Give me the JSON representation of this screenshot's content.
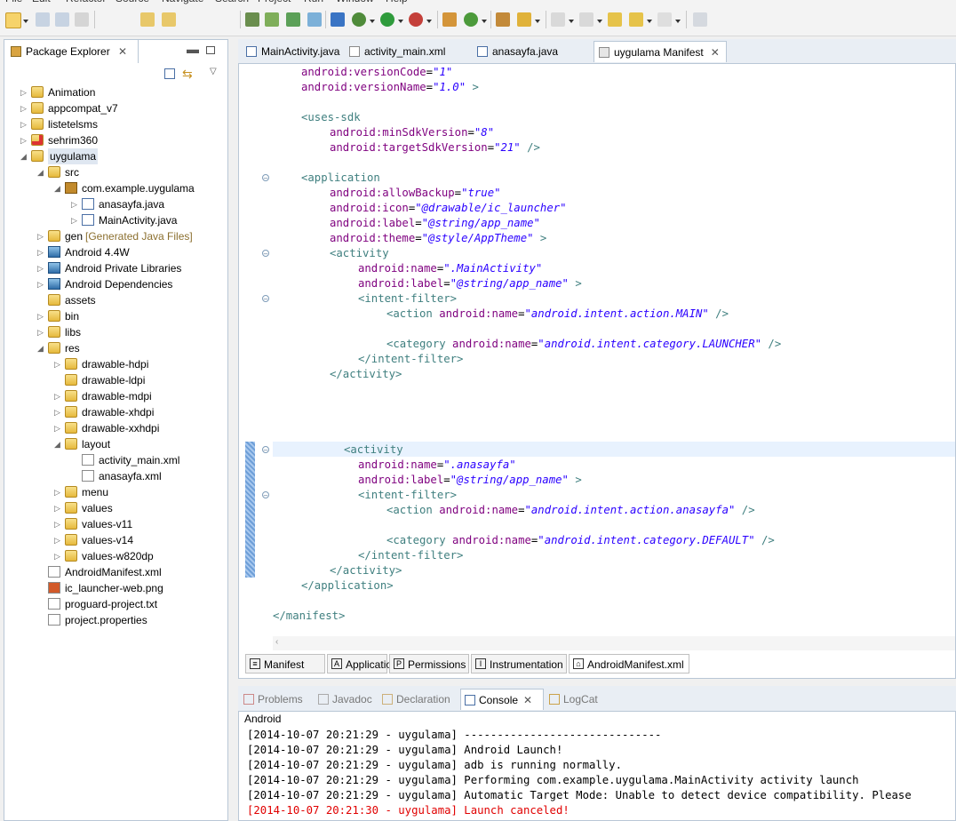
{
  "menu": [
    "File",
    "Edit",
    "Refactor",
    "Source",
    "Navigate",
    "Search",
    "Project",
    "Run",
    "Window",
    "Help"
  ],
  "explorer": {
    "title": "Package Explorer",
    "items": [
      {
        "label": "Animation",
        "level": 0,
        "icon": "project-icon",
        "expand": "collapsed"
      },
      {
        "label": "appcompat_v7",
        "level": 0,
        "icon": "project-icon",
        "expand": "collapsed"
      },
      {
        "label": "listetelsms",
        "level": 0,
        "icon": "project-icon",
        "expand": "collapsed"
      },
      {
        "label": "sehrim360",
        "level": 0,
        "icon": "project-error-icon",
        "expand": "collapsed"
      },
      {
        "label": "uygulama",
        "level": 0,
        "icon": "project-icon",
        "expand": "expanded",
        "selected": true
      },
      {
        "label": "src",
        "level": 1,
        "icon": "source-folder-icon",
        "expand": "expanded"
      },
      {
        "label": "com.example.uygulama",
        "level": 2,
        "icon": "package-icon",
        "expand": "expanded"
      },
      {
        "label": "anasayfa.java",
        "level": 3,
        "icon": "java-file-icon",
        "expand": "collapsed"
      },
      {
        "label": "MainActivity.java",
        "level": 3,
        "icon": "java-file-icon",
        "expand": "collapsed"
      },
      {
        "label": "gen",
        "suffix": "[Generated Java Files]",
        "level": 1,
        "icon": "source-folder-icon",
        "expand": "collapsed"
      },
      {
        "label": "Android 4.4W",
        "level": 1,
        "icon": "library-icon",
        "expand": "collapsed"
      },
      {
        "label": "Android Private Libraries",
        "level": 1,
        "icon": "library-icon",
        "expand": "collapsed"
      },
      {
        "label": "Android Dependencies",
        "level": 1,
        "icon": "library-icon",
        "expand": "collapsed"
      },
      {
        "label": "assets",
        "level": 1,
        "icon": "folder-icon",
        "expand": "none"
      },
      {
        "label": "bin",
        "level": 1,
        "icon": "folder-icon",
        "expand": "collapsed"
      },
      {
        "label": "libs",
        "level": 1,
        "icon": "folder-icon",
        "expand": "collapsed"
      },
      {
        "label": "res",
        "level": 1,
        "icon": "folder-icon",
        "expand": "expanded"
      },
      {
        "label": "drawable-hdpi",
        "level": 2,
        "icon": "folder-icon",
        "expand": "collapsed"
      },
      {
        "label": "drawable-ldpi",
        "level": 2,
        "icon": "folder-icon",
        "expand": "none"
      },
      {
        "label": "drawable-mdpi",
        "level": 2,
        "icon": "folder-icon",
        "expand": "collapsed"
      },
      {
        "label": "drawable-xhdpi",
        "level": 2,
        "icon": "folder-icon",
        "expand": "collapsed"
      },
      {
        "label": "drawable-xxhdpi",
        "level": 2,
        "icon": "folder-icon",
        "expand": "collapsed"
      },
      {
        "label": "layout",
        "level": 2,
        "icon": "folder-icon",
        "expand": "expanded"
      },
      {
        "label": "activity_main.xml",
        "level": 3,
        "icon": "xml-file-icon",
        "expand": "none"
      },
      {
        "label": "anasayfa.xml",
        "level": 3,
        "icon": "xml-file-icon",
        "expand": "none"
      },
      {
        "label": "menu",
        "level": 2,
        "icon": "folder-icon",
        "expand": "collapsed"
      },
      {
        "label": "values",
        "level": 2,
        "icon": "folder-icon",
        "expand": "collapsed"
      },
      {
        "label": "values-v11",
        "level": 2,
        "icon": "folder-icon",
        "expand": "collapsed"
      },
      {
        "label": "values-v14",
        "level": 2,
        "icon": "folder-icon",
        "expand": "collapsed"
      },
      {
        "label": "values-w820dp",
        "level": 2,
        "icon": "folder-icon",
        "expand": "collapsed"
      },
      {
        "label": "AndroidManifest.xml",
        "level": 1,
        "icon": "xml-file-icon",
        "expand": "none"
      },
      {
        "label": "ic_launcher-web.png",
        "level": 1,
        "icon": "image-file-icon",
        "expand": "none"
      },
      {
        "label": "proguard-project.txt",
        "level": 1,
        "icon": "text-file-icon",
        "expand": "none"
      },
      {
        "label": "project.properties",
        "level": 1,
        "icon": "text-file-icon",
        "expand": "none"
      }
    ]
  },
  "editor_tabs": [
    {
      "label": "MainActivity.java",
      "icon": "java-file-icon",
      "active": false
    },
    {
      "label": "activity_main.xml",
      "icon": "xml-file-icon",
      "active": false
    },
    {
      "label": "anasayfa.java",
      "icon": "java-file-icon",
      "active": false
    },
    {
      "label": "uygulama Manifest",
      "icon": "manifest-icon",
      "active": true
    }
  ],
  "code_lines": [
    {
      "indent": 1,
      "parts": [
        [
          "an",
          "android:versionCode"
        ],
        [
          "bk",
          "="
        ],
        [
          "av",
          "\"1\""
        ]
      ]
    },
    {
      "indent": 1,
      "parts": [
        [
          "an",
          "android:versionName"
        ],
        [
          "bk",
          "="
        ],
        [
          "av",
          "\"1.0\""
        ],
        [
          "tg",
          " >"
        ]
      ]
    },
    {
      "indent": 0,
      "parts": []
    },
    {
      "indent": 1,
      "parts": [
        [
          "tg",
          "<uses-sdk"
        ]
      ]
    },
    {
      "indent": 2,
      "parts": [
        [
          "an",
          "android:minSdkVersion"
        ],
        [
          "bk",
          "="
        ],
        [
          "av",
          "\"8\""
        ]
      ]
    },
    {
      "indent": 2,
      "parts": [
        [
          "an",
          "android:targetSdkVersion"
        ],
        [
          "bk",
          "="
        ],
        [
          "av",
          "\"21\""
        ],
        [
          "tg",
          " />"
        ]
      ]
    },
    {
      "indent": 0,
      "parts": []
    },
    {
      "indent": 1,
      "parts": [
        [
          "tg",
          "<application"
        ]
      ],
      "fold": true
    },
    {
      "indent": 2,
      "parts": [
        [
          "an",
          "android:allowBackup"
        ],
        [
          "bk",
          "="
        ],
        [
          "av",
          "\"true\""
        ]
      ]
    },
    {
      "indent": 2,
      "parts": [
        [
          "an",
          "android:icon"
        ],
        [
          "bk",
          "="
        ],
        [
          "av",
          "\"@drawable/ic_launcher\""
        ]
      ]
    },
    {
      "indent": 2,
      "parts": [
        [
          "an",
          "android:label"
        ],
        [
          "bk",
          "="
        ],
        [
          "av",
          "\"@string/app_name\""
        ]
      ]
    },
    {
      "indent": 2,
      "parts": [
        [
          "an",
          "android:theme"
        ],
        [
          "bk",
          "="
        ],
        [
          "av",
          "\"@style/AppTheme\""
        ],
        [
          "tg",
          " >"
        ]
      ]
    },
    {
      "indent": 2,
      "parts": [
        [
          "tg",
          "<activity"
        ]
      ],
      "fold": true
    },
    {
      "indent": 3,
      "parts": [
        [
          "an",
          "android:name"
        ],
        [
          "bk",
          "="
        ],
        [
          "av",
          "\".MainActivity\""
        ]
      ]
    },
    {
      "indent": 3,
      "parts": [
        [
          "an",
          "android:label"
        ],
        [
          "bk",
          "="
        ],
        [
          "av",
          "\"@string/app_name\""
        ],
        [
          "tg",
          " >"
        ]
      ]
    },
    {
      "indent": 3,
      "parts": [
        [
          "tg",
          "<intent-filter>"
        ]
      ],
      "fold": true
    },
    {
      "indent": 4,
      "parts": [
        [
          "tg",
          "<action "
        ],
        [
          "an",
          "android:name"
        ],
        [
          "bk",
          "="
        ],
        [
          "av",
          "\"android.intent.action.MAIN\""
        ],
        [
          "tg",
          " />"
        ]
      ]
    },
    {
      "indent": 0,
      "parts": []
    },
    {
      "indent": 4,
      "parts": [
        [
          "tg",
          "<category "
        ],
        [
          "an",
          "android:name"
        ],
        [
          "bk",
          "="
        ],
        [
          "av",
          "\"android.intent.category.LAUNCHER\""
        ],
        [
          "tg",
          " />"
        ]
      ]
    },
    {
      "indent": 3,
      "parts": [
        [
          "tg",
          "</intent-filter>"
        ]
      ]
    },
    {
      "indent": 2,
      "parts": [
        [
          "tg",
          "</activity>"
        ]
      ]
    },
    {
      "indent": 0,
      "parts": []
    },
    {
      "indent": 0,
      "parts": []
    },
    {
      "indent": 0,
      "parts": []
    },
    {
      "indent": 0,
      "parts": []
    },
    {
      "indent": 2.5,
      "parts": [
        [
          "tg",
          "<activity"
        ]
      ],
      "fold": true,
      "current": true
    },
    {
      "indent": 3,
      "parts": [
        [
          "an",
          "android:name"
        ],
        [
          "bk",
          "="
        ],
        [
          "av",
          "\".anasayfa\""
        ]
      ]
    },
    {
      "indent": 3,
      "parts": [
        [
          "an",
          "android:label"
        ],
        [
          "bk",
          "="
        ],
        [
          "av",
          "\"@string/app_name\""
        ],
        [
          "tg",
          " >"
        ]
      ]
    },
    {
      "indent": 3,
      "parts": [
        [
          "tg",
          "<intent-filter>"
        ]
      ],
      "fold": true
    },
    {
      "indent": 4,
      "parts": [
        [
          "tg",
          "<action "
        ],
        [
          "an",
          "android:name"
        ],
        [
          "bk",
          "="
        ],
        [
          "av",
          "\"android.intent.action.anasayfa\""
        ],
        [
          "tg",
          " />"
        ]
      ]
    },
    {
      "indent": 0,
      "parts": []
    },
    {
      "indent": 4,
      "parts": [
        [
          "tg",
          "<category "
        ],
        [
          "an",
          "android:name"
        ],
        [
          "bk",
          "="
        ],
        [
          "av",
          "\"android.intent.category.DEFAULT\""
        ],
        [
          "tg",
          " />"
        ]
      ]
    },
    {
      "indent": 3,
      "parts": [
        [
          "tg",
          "</intent-filter>"
        ]
      ]
    },
    {
      "indent": 2,
      "parts": [
        [
          "tg",
          "</activity>"
        ]
      ]
    },
    {
      "indent": 1,
      "parts": [
        [
          "tg",
          "</application>"
        ]
      ]
    },
    {
      "indent": 0,
      "parts": []
    },
    {
      "indent": 0,
      "parts": [
        [
          "tg",
          "</manifest>"
        ]
      ]
    }
  ],
  "manifest_tabs": [
    {
      "label": "Manifest",
      "icon": "manifest-icon"
    },
    {
      "label": "Application",
      "icon": "application-icon"
    },
    {
      "label": "Permissions",
      "icon": "permissions-icon"
    },
    {
      "label": "Instrumentation",
      "icon": "instrumentation-icon"
    },
    {
      "label": "AndroidManifest.xml",
      "icon": "xml-file-icon",
      "active": true
    }
  ],
  "console": {
    "tabs": [
      {
        "label": "Problems",
        "icon": "problems-icon",
        "active": false
      },
      {
        "label": "Javadoc",
        "icon": "javadoc-icon",
        "active": false
      },
      {
        "label": "Declaration",
        "icon": "declaration-icon",
        "active": false
      },
      {
        "label": "Console",
        "icon": "console-icon",
        "active": true
      },
      {
        "label": "LogCat",
        "icon": "logcat-icon",
        "active": false
      }
    ],
    "header": "Android",
    "lines": [
      {
        "text": "[2014-10-07 20:21:29 - uygulama] ------------------------------",
        "error": false
      },
      {
        "text": "[2014-10-07 20:21:29 - uygulama] Android Launch!",
        "error": false
      },
      {
        "text": "[2014-10-07 20:21:29 - uygulama] adb is running normally.",
        "error": false
      },
      {
        "text": "[2014-10-07 20:21:29 - uygulama] Performing com.example.uygulama.MainActivity activity launch",
        "error": false
      },
      {
        "text": "[2014-10-07 20:21:29 - uygulama] Automatic Target Mode: Unable to detect device compatibility. Please",
        "error": false
      },
      {
        "text": "[2014-10-07 20:21:30 - uygulama] Launch canceled!",
        "error": true
      }
    ]
  },
  "colors": {
    "tag": "#3f7f7f",
    "attr_name": "#7f007f",
    "attr_value": "#2a00ff",
    "error": "#e00000",
    "current_line": "#e8f2fe"
  }
}
